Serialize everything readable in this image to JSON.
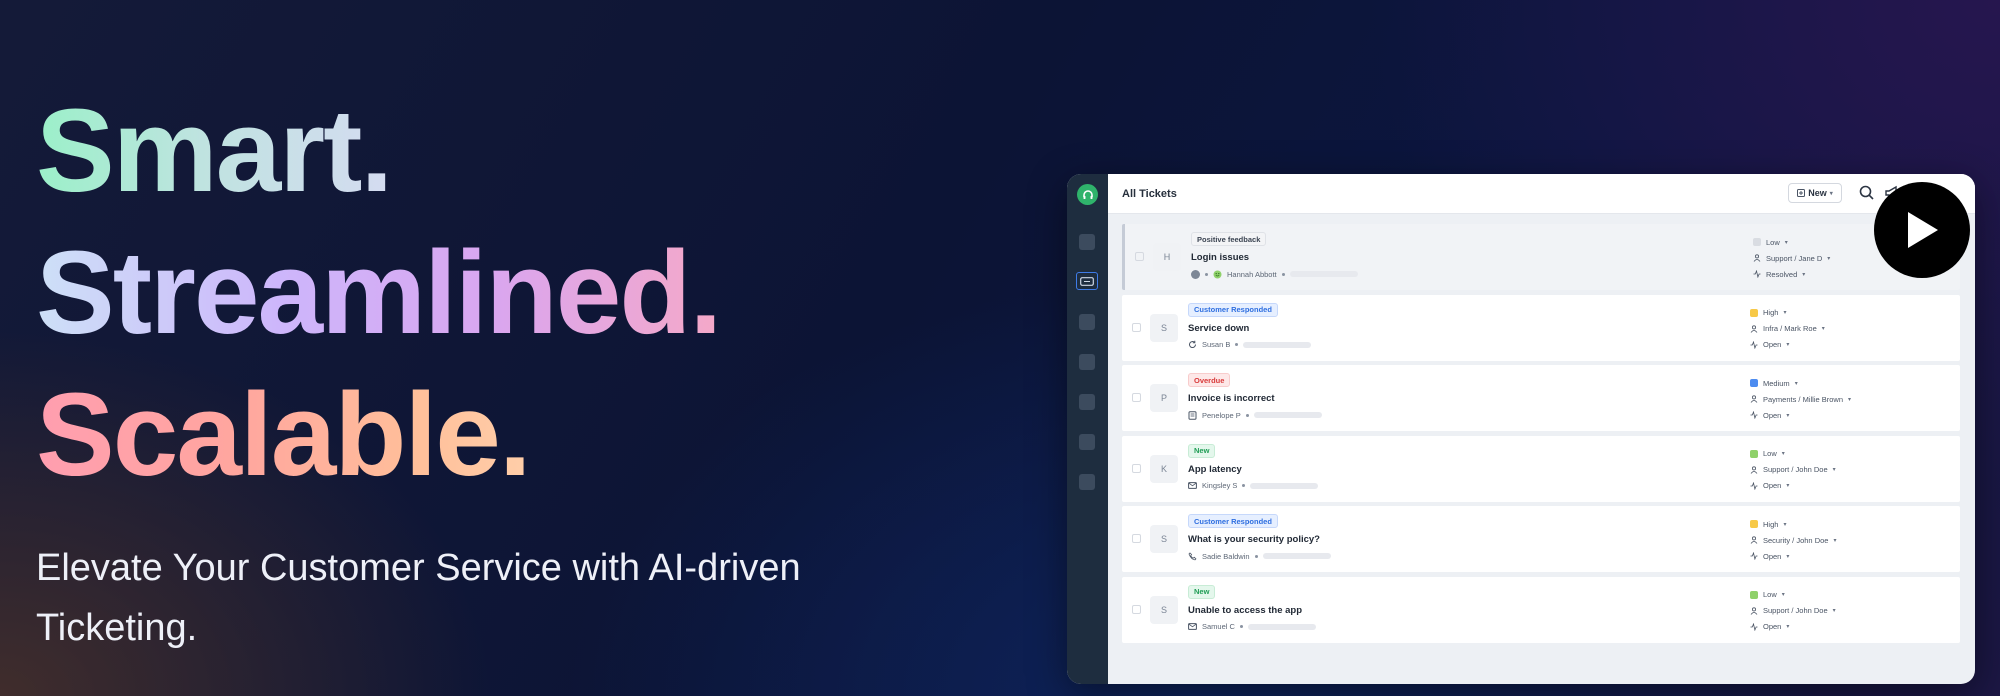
{
  "hero": {
    "line1": "Smart.",
    "line2": "Streamlined.",
    "line3": "Scalable.",
    "subtitle": "Elevate Your Customer Service with AI-driven Ticketing."
  },
  "app": {
    "title": "All Tickets",
    "new_button": "New",
    "icons": [
      "search-icon",
      "megaphone-icon",
      "user-avatar"
    ],
    "tickets": [
      {
        "initial": "H",
        "tag": "Positive feedback",
        "tag_style": "gray",
        "subject": "Login issues",
        "requester": "Hannah Abbott",
        "channel_icon": "smile-icon",
        "priority": "Low",
        "priority_color": "#d9dce2",
        "team": "Support / Jane D",
        "status": "Resolved"
      },
      {
        "initial": "S",
        "tag": "Customer Responded",
        "tag_style": "blue",
        "subject": "Service down",
        "requester": "Susan B",
        "channel_icon": "refresh-icon",
        "priority": "High",
        "priority_color": "#f7c948",
        "team": "Infra / Mark Roe",
        "status": "Open"
      },
      {
        "initial": "P",
        "tag": "Overdue",
        "tag_style": "red",
        "subject": "Invoice is incorrect",
        "requester": "Penelope P",
        "channel_icon": "form-icon",
        "priority": "Medium",
        "priority_color": "#4d8cf0",
        "team": "Payments / Millie Brown",
        "status": "Open"
      },
      {
        "initial": "K",
        "tag": "New",
        "tag_style": "green",
        "subject": "App latency",
        "requester": "Kingsley S",
        "channel_icon": "mail-icon",
        "priority": "Low",
        "priority_color": "#8fd16a",
        "team": "Support / John Doe",
        "status": "Open"
      },
      {
        "initial": "S",
        "tag": "Customer Responded",
        "tag_style": "blue",
        "subject": "What is your security policy?",
        "requester": "Sadie Baldwin",
        "channel_icon": "phone-icon",
        "priority": "High",
        "priority_color": "#f7c948",
        "team": "Security / John Doe",
        "status": "Open"
      },
      {
        "initial": "S",
        "tag": "New",
        "tag_style": "green",
        "subject": "Unable to access the app",
        "requester": "Samuel C",
        "channel_icon": "mail-icon",
        "priority": "Low",
        "priority_color": "#8fd16a",
        "team": "Support / John Doe",
        "status": "Open"
      }
    ]
  },
  "video": {
    "icon": "play-icon"
  }
}
